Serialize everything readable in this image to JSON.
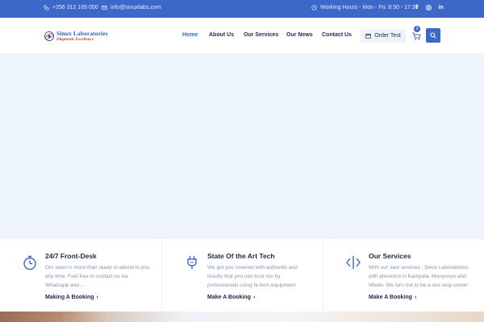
{
  "topbar": {
    "phone": "+256 312 165 050",
    "email": "info@sinuxlabs.com",
    "hours": "Working Hours - Mon - Fri: 8:30 - 17:30",
    "social": [
      "facebook-icon",
      "instagram-icon",
      "linkedin-icon"
    ]
  },
  "header": {
    "logo_name": "Sinux Laboratories",
    "logo_tagline": "Diagnostic Excellence",
    "nav": {
      "home": "Home",
      "about": "About Us",
      "services": "Our Services",
      "news": "Our News",
      "contact": "Contact Us"
    },
    "order_label": "Order Test",
    "cart_count": "0"
  },
  "features": [
    {
      "title": "24/7 Front-Desk",
      "description": "Our team is more than ready to attend to you any time. Feel free to contact us via Whatsapp and ...",
      "link": "Making A Booking",
      "icon": "stopwatch-icon"
    },
    {
      "title": "State Of the Art Tech",
      "description": "We got you covered with authentic and results that you can trust run by professionals using hi-tech equipment",
      "link": "Make A Booking",
      "icon": "plug-icon"
    },
    {
      "title": "Our Services",
      "description": "With our vast services , Sinux Laboratories with presence in Kampala, Munyonyo and Mbale. We turn out to be a one stop center",
      "link": "Make A Booking",
      "icon": "code-brackets-icon"
    }
  ],
  "colors": {
    "brand": "#3b68c9",
    "heading": "#1c2b4a",
    "muted": "#8a94a6",
    "hero_bg": "#eef4fc"
  }
}
